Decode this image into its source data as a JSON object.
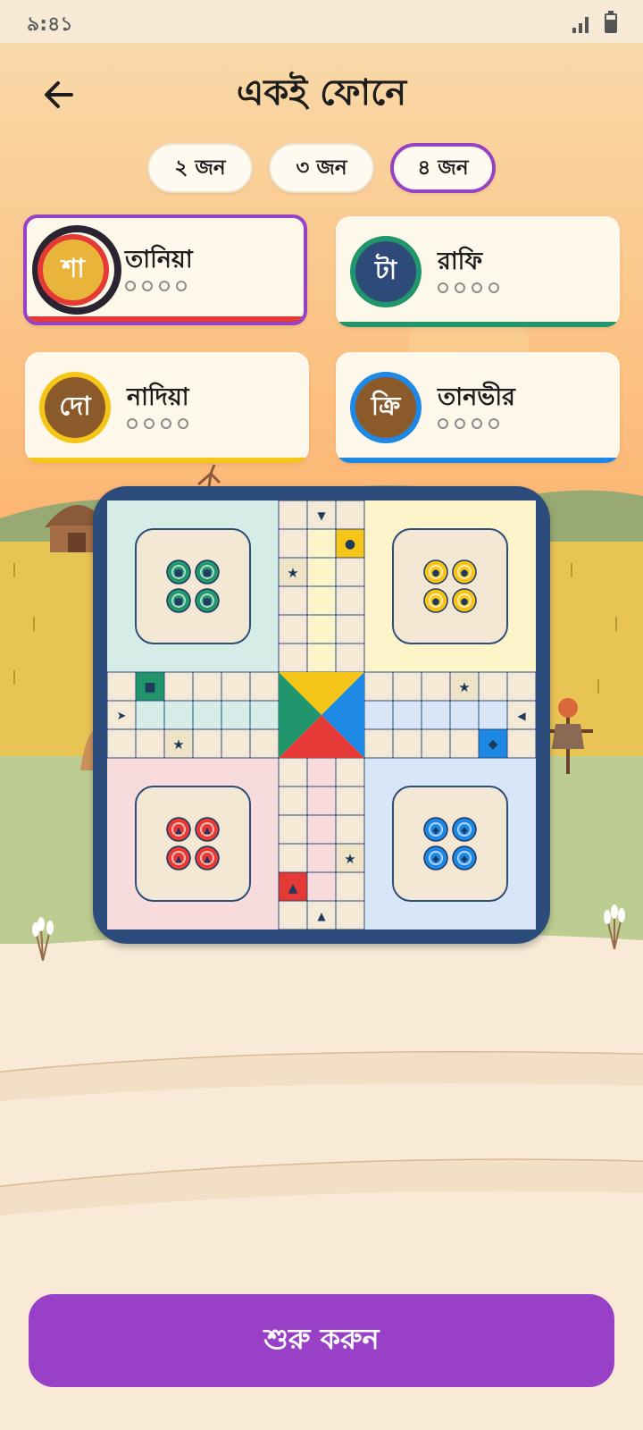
{
  "status_bar": {
    "time": "৯:৪১",
    "signal_icon": "signal-icon",
    "battery_icon": "battery-icon"
  },
  "header": {
    "title": "একই ফোনে",
    "back_icon": "arrow-left-icon"
  },
  "player_count": {
    "options": [
      "২ জন",
      "৩ জন",
      "৪ জন"
    ],
    "selected": "৪ জন"
  },
  "players": [
    {
      "name": "তানিয়া",
      "avatar": "শা",
      "color": "#e53935",
      "avatar_bg": "#e8b53a",
      "selected": true
    },
    {
      "name": "রাফি",
      "avatar": "টা",
      "color": "#21956c",
      "avatar_bg": "#2d4a7a",
      "selected": false
    },
    {
      "name": "নাদিয়া",
      "avatar": "দো",
      "color": "#f5c518",
      "avatar_bg": "#8a5a2b",
      "selected": false
    },
    {
      "name": "তানভীর",
      "avatar": "ক্রি",
      "color": "#1e88e5",
      "avatar_bg": "#8a5a2b",
      "selected": false
    }
  ],
  "board": {
    "colors": {
      "green": "#21956c",
      "yellow": "#f5c518",
      "red": "#e53935",
      "blue": "#1e88e5"
    },
    "home_tints": {
      "green": "#d5ede6",
      "yellow": "#fdf3c8",
      "red": "#f8dcdc",
      "blue": "#d8e6f8"
    },
    "token_symbols": {
      "green": "■",
      "yellow": "●",
      "red": "▲",
      "blue": "◆"
    }
  },
  "start_button": {
    "label": "শুরু করুন"
  }
}
